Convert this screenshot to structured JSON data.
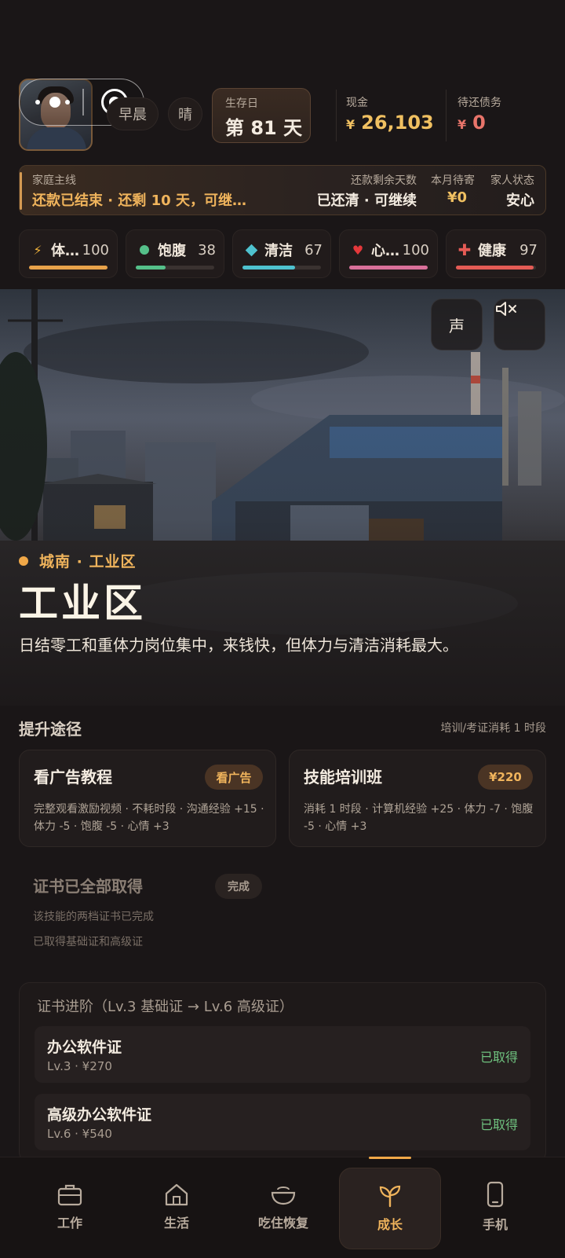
{
  "header": {
    "time_of_day": "早晨",
    "weather": "晴",
    "day_label": "生存日",
    "day_value": "第 81 天",
    "cash_label": "现金",
    "cash_currency": "¥",
    "cash_value": "26,103",
    "debt_label": "待还债务",
    "debt_currency": "¥",
    "debt_value": "0"
  },
  "family": {
    "main_label": "家庭主线",
    "main_value": "还款已结束 · 还剩 10 天，可继…",
    "days_label": "还款剩余天数",
    "days_value": "已还清 · 可继续",
    "monthly_label": "本月待寄",
    "monthly_value": "¥0",
    "state_label": "家人状态",
    "state_value": "安心"
  },
  "stats": [
    {
      "icon": "lightning-icon",
      "name": "体…",
      "value": "100",
      "level": 1.0,
      "color": "#e8a24a"
    },
    {
      "icon": "circle-icon",
      "name": "饱腹",
      "value": "38",
      "level": 0.38,
      "color": "#55c08a"
    },
    {
      "icon": "diamond-icon",
      "name": "清洁",
      "value": "67",
      "level": 0.67,
      "color": "#4ec2cf"
    },
    {
      "icon": "heart-icon",
      "name": "心…",
      "value": "100",
      "level": 1.0,
      "color": "#d9709a"
    },
    {
      "icon": "plus-icon",
      "name": "健康",
      "value": "97",
      "level": 0.97,
      "color": "#e45b55"
    }
  ],
  "hero": {
    "sound_label": "声",
    "location": "城南 · 工业区",
    "title": "工业区",
    "description": "日结零工和重体力岗位集中，来钱快，但体力与清洁消耗最大。"
  },
  "growth": {
    "title": "提升途径",
    "note": "培训/考证消耗 1 时段",
    "cards": [
      {
        "title": "看广告教程",
        "tag": "看广告",
        "desc": "完整观看激励视频 · 不耗时段 · 沟通经验 +15 · 体力 -5 · 饱腹 -5 · 心情 +3"
      },
      {
        "title": "技能培训班",
        "tag": "¥220",
        "desc": "消耗 1 时段 · 计算机经验 +25 · 体力 -7 · 饱腹 -5 · 心情 +3"
      }
    ],
    "cert_done": {
      "title": "证书已全部取得",
      "tag": "完成",
      "line1": "该技能的两档证书已完成",
      "line2": "已取得基础证和高级证"
    },
    "cert_panel": {
      "title": "证书进阶（Lv.3 基础证 → Lv.6 高级证）",
      "items": [
        {
          "name": "办公软件证",
          "sub": "Lv.3 · ¥270",
          "status": "已取得"
        },
        {
          "name": "高级办公软件证",
          "sub": "Lv.6 · ¥540",
          "status": "已取得"
        }
      ]
    }
  },
  "nav": {
    "items": [
      {
        "label": "工作",
        "icon": "briefcase-icon"
      },
      {
        "label": "生活",
        "icon": "home-icon"
      },
      {
        "label": "吃住恢复",
        "icon": "bowl-icon"
      },
      {
        "label": "成长",
        "icon": "sprout-icon",
        "active": true
      },
      {
        "label": "手机",
        "icon": "phone-icon"
      }
    ]
  },
  "colors": {
    "accent": "#f0b45c",
    "cash": "#f0c061",
    "debt": "#e8746a",
    "success": "#6fc27f",
    "background": "#1a1617"
  }
}
